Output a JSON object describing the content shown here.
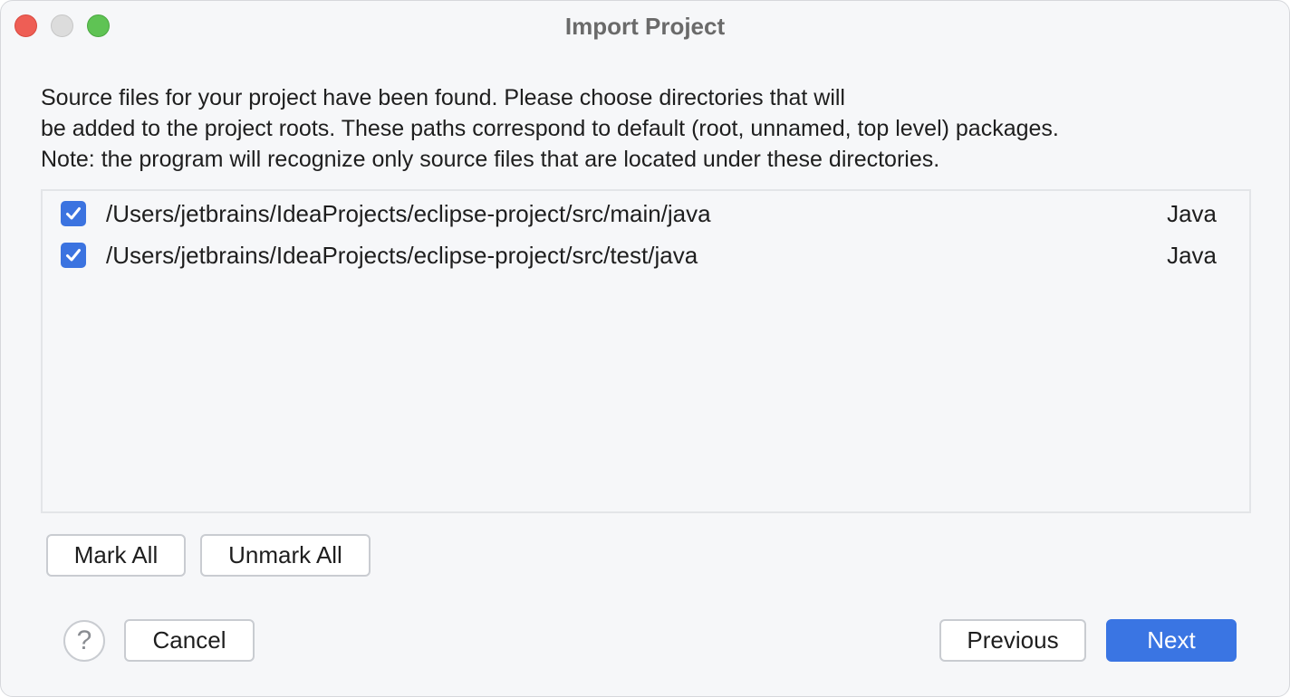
{
  "window": {
    "title": "Import Project"
  },
  "description": {
    "line1": "Source files for your project have been found. Please choose directories that will",
    "line2": "be added to the project roots. These paths correspond to default (root, unnamed, top level) packages.",
    "line3": "Note: the program will recognize only source files that are located under these directories."
  },
  "roots": [
    {
      "checked": true,
      "path": "/Users/jetbrains/IdeaProjects/eclipse-project/src/main/java",
      "type": "Java"
    },
    {
      "checked": true,
      "path": "/Users/jetbrains/IdeaProjects/eclipse-project/src/test/java",
      "type": "Java"
    }
  ],
  "mark_buttons": {
    "mark_all": "Mark All",
    "unmark_all": "Unmark All"
  },
  "footer": {
    "help_icon": "question-mark-icon",
    "help_glyph": "?",
    "cancel": "Cancel",
    "previous": "Previous",
    "next": "Next"
  },
  "colors": {
    "accent": "#3a75e3",
    "checkbox": "#3b73e0",
    "close": "#ee5e55",
    "minimize": "#dcdcdc",
    "maximize": "#5fc354"
  }
}
